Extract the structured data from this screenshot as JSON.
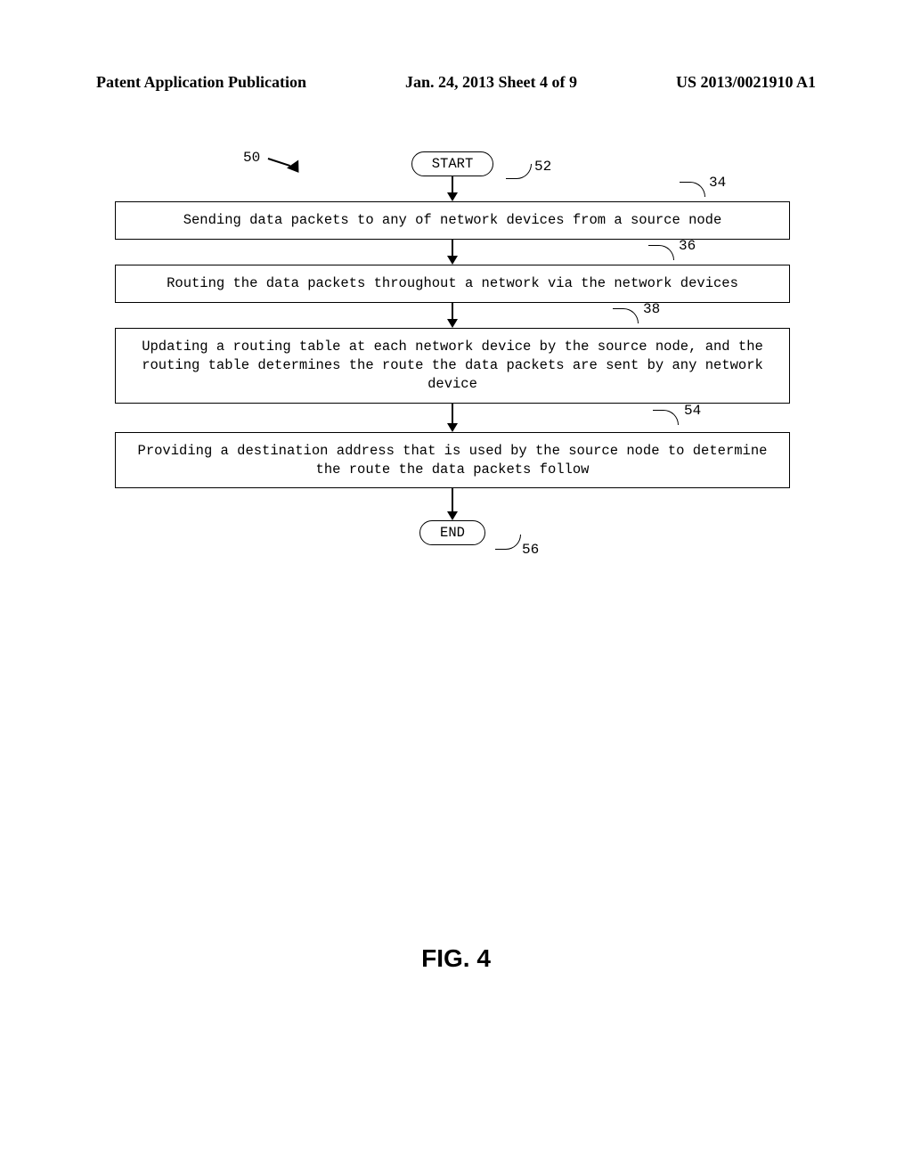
{
  "header": {
    "left": "Patent Application Publication",
    "center": "Jan. 24, 2013  Sheet 4 of 9",
    "right": "US 2013/0021910 A1"
  },
  "flow": {
    "start": "START",
    "step1": "Sending data packets to any of network devices from a source node",
    "step2": "Routing the data packets throughout a network via the network devices",
    "step3": "Updating a routing table at each network device by the source node, and the routing table determines the route the data packets are sent by any network device",
    "step4": "Providing a destination address that is used by the source node to determine the route the data packets follow",
    "end": "END"
  },
  "labels": {
    "ref50": "50",
    "ref52": "52",
    "ref34": "34",
    "ref36": "36",
    "ref38": "38",
    "ref54": "54",
    "ref56": "56"
  },
  "figure_caption": "FIG. 4"
}
